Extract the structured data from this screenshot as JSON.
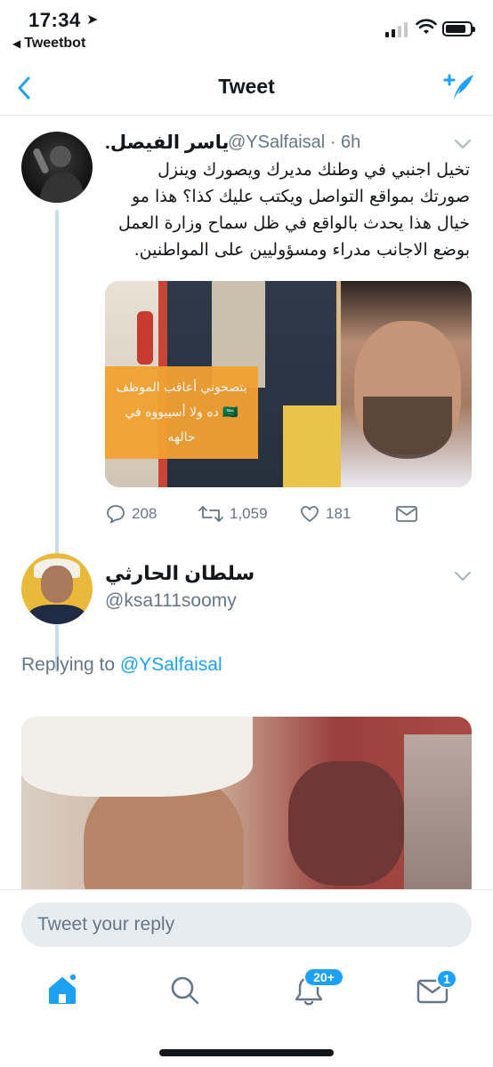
{
  "status_bar": {
    "time": "17:34",
    "location_glyph": "➤",
    "back_app": "Tweetbot"
  },
  "nav": {
    "title": "Tweet"
  },
  "tweet": {
    "name": "ياسر الفيصل.",
    "handle": "@YSalfaisal",
    "time": "· 6h",
    "text": "تخيل اجنبي في وطنك مديرك ويصورك وينزل صورتك بمواقع التواصل ويكتب عليك كذا؟ هذا مو خيال هذا يحدث بالواقع في ظل سماح وزارة العمل بوضع الاجانب مدراء ومسؤوليين على المواطنين.",
    "image_caption": "بتصحوني أعاقب الموظف 🇸🇦 ده ولا أسيبووه في حالهه",
    "replies": "208",
    "retweets": "1,059",
    "likes": "181"
  },
  "reply": {
    "name": "سلطان الحارثي",
    "handle": "@ksa111soomy",
    "replying_prefix": "Replying to ",
    "replying_to": "@YSalfaisal"
  },
  "composer": {
    "placeholder": "Tweet your reply"
  },
  "tabs": {
    "notifications_badge": "20+",
    "messages_badge": "1"
  },
  "colors": {
    "accent": "#1da1f2",
    "secondary_text": "#657786",
    "thread_line": "#c9dbe8"
  }
}
